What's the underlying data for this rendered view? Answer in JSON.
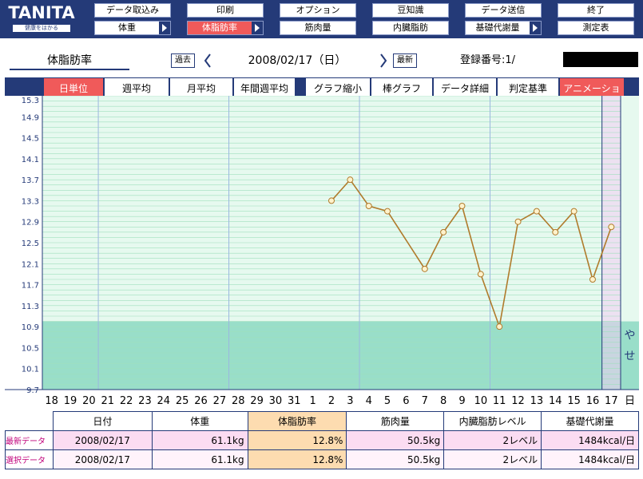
{
  "logo": {
    "text": "TANITA",
    "tagline": "健康をはかる"
  },
  "menu": {
    "row1": [
      {
        "label": "データ取込み"
      },
      {
        "label": "印刷"
      },
      {
        "label": "オプション"
      },
      {
        "label": "豆知識"
      },
      {
        "label": "データ送信"
      },
      {
        "label": "終了"
      }
    ],
    "row2": [
      {
        "label": "体重"
      },
      {
        "label": "体脂肪率"
      },
      {
        "label": "筋肉量"
      },
      {
        "label": "内臓脂肪"
      },
      {
        "label": "基礎代謝量"
      },
      {
        "label": "測定表"
      }
    ]
  },
  "header": {
    "title": "体脂肪率",
    "prev_label": "過去",
    "date": "2008/02/17（日）",
    "latest_label": "最新",
    "reg_label": "登録番号:1/"
  },
  "tabs": {
    "unit": "%",
    "items": [
      "日単位",
      "週平均",
      "月平均",
      "年間週平均",
      "グラフ縮小",
      "棒グラフ",
      "データ詳細",
      "判定基準",
      "アニメーション"
    ]
  },
  "chart_data": {
    "type": "line",
    "ylabel": "%",
    "ylim": [
      9.7,
      15.3
    ],
    "yticks": [
      "15.3",
      "14.9",
      "14.5",
      "14.1",
      "13.7",
      "13.3",
      "12.9",
      "12.5",
      "12.1",
      "11.7",
      "11.3",
      "10.9",
      "10.5",
      "10.1",
      "9.7"
    ],
    "categories": [
      "18",
      "19",
      "20",
      "21",
      "22",
      "23",
      "24",
      "25",
      "26",
      "27",
      "28",
      "29",
      "30",
      "31",
      "1",
      "2",
      "3",
      "4",
      "5",
      "6",
      "7",
      "8",
      "9",
      "10",
      "11",
      "12",
      "13",
      "14",
      "15",
      "16",
      "17"
    ],
    "current_label": "日",
    "band_label": [
      "や",
      "せ"
    ],
    "band_max": 11.0,
    "series": [
      {
        "x": [
          "2",
          "3",
          "4",
          "5",
          "7",
          "8",
          "9",
          "10",
          "11",
          "12",
          "13",
          "14",
          "15",
          "16",
          "17"
        ],
        "values": [
          13.3,
          13.7,
          13.2,
          13.1,
          12.0,
          12.7,
          13.2,
          11.9,
          10.9,
          12.9,
          13.1,
          12.7,
          13.1,
          11.8,
          12.8
        ]
      }
    ],
    "colors": {
      "line": "#b07b2c",
      "point_fill": "#fff2cc",
      "grid": "#9fe0bd",
      "band": "#99dec9",
      "bg": "#e6f9ef",
      "current": "#f0cdf2"
    }
  },
  "table": {
    "headers": [
      "日付",
      "体重",
      "体脂肪率",
      "筋肉量",
      "内臓脂肪レベル",
      "基礎代謝量"
    ],
    "rows": [
      {
        "label": "最新データ",
        "values": [
          "2008/02/17",
          "61.1kg",
          "12.8%",
          "50.5kg",
          "2レベル",
          "1484kcal/日"
        ]
      },
      {
        "label": "選択データ",
        "values": [
          "2008/02/17",
          "61.1kg",
          "12.8%",
          "50.5kg",
          "2レベル",
          "1484kcal/日"
        ]
      }
    ]
  }
}
